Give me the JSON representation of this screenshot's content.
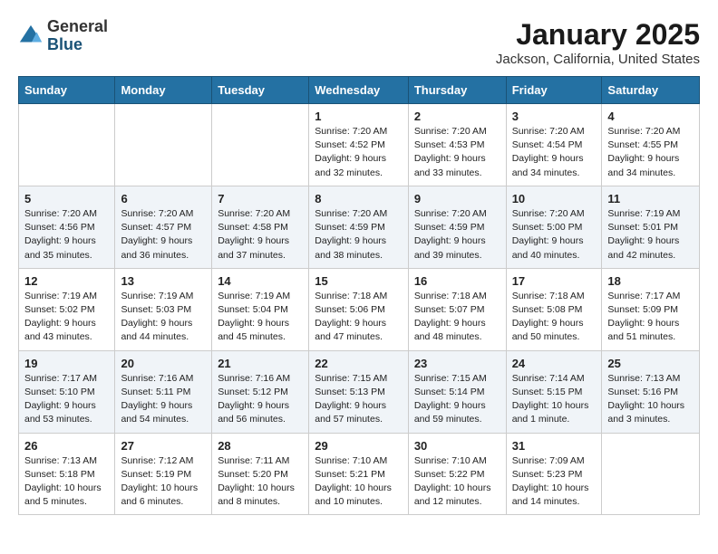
{
  "logo": {
    "general": "General",
    "blue": "Blue"
  },
  "title": "January 2025",
  "subtitle": "Jackson, California, United States",
  "days_of_week": [
    "Sunday",
    "Monday",
    "Tuesday",
    "Wednesday",
    "Thursday",
    "Friday",
    "Saturday"
  ],
  "weeks": [
    [
      {
        "day": "",
        "info": ""
      },
      {
        "day": "",
        "info": ""
      },
      {
        "day": "",
        "info": ""
      },
      {
        "day": "1",
        "info": "Sunrise: 7:20 AM\nSunset: 4:52 PM\nDaylight: 9 hours and 32 minutes."
      },
      {
        "day": "2",
        "info": "Sunrise: 7:20 AM\nSunset: 4:53 PM\nDaylight: 9 hours and 33 minutes."
      },
      {
        "day": "3",
        "info": "Sunrise: 7:20 AM\nSunset: 4:54 PM\nDaylight: 9 hours and 34 minutes."
      },
      {
        "day": "4",
        "info": "Sunrise: 7:20 AM\nSunset: 4:55 PM\nDaylight: 9 hours and 34 minutes."
      }
    ],
    [
      {
        "day": "5",
        "info": "Sunrise: 7:20 AM\nSunset: 4:56 PM\nDaylight: 9 hours and 35 minutes."
      },
      {
        "day": "6",
        "info": "Sunrise: 7:20 AM\nSunset: 4:57 PM\nDaylight: 9 hours and 36 minutes."
      },
      {
        "day": "7",
        "info": "Sunrise: 7:20 AM\nSunset: 4:58 PM\nDaylight: 9 hours and 37 minutes."
      },
      {
        "day": "8",
        "info": "Sunrise: 7:20 AM\nSunset: 4:59 PM\nDaylight: 9 hours and 38 minutes."
      },
      {
        "day": "9",
        "info": "Sunrise: 7:20 AM\nSunset: 4:59 PM\nDaylight: 9 hours and 39 minutes."
      },
      {
        "day": "10",
        "info": "Sunrise: 7:20 AM\nSunset: 5:00 PM\nDaylight: 9 hours and 40 minutes."
      },
      {
        "day": "11",
        "info": "Sunrise: 7:19 AM\nSunset: 5:01 PM\nDaylight: 9 hours and 42 minutes."
      }
    ],
    [
      {
        "day": "12",
        "info": "Sunrise: 7:19 AM\nSunset: 5:02 PM\nDaylight: 9 hours and 43 minutes."
      },
      {
        "day": "13",
        "info": "Sunrise: 7:19 AM\nSunset: 5:03 PM\nDaylight: 9 hours and 44 minutes."
      },
      {
        "day": "14",
        "info": "Sunrise: 7:19 AM\nSunset: 5:04 PM\nDaylight: 9 hours and 45 minutes."
      },
      {
        "day": "15",
        "info": "Sunrise: 7:18 AM\nSunset: 5:06 PM\nDaylight: 9 hours and 47 minutes."
      },
      {
        "day": "16",
        "info": "Sunrise: 7:18 AM\nSunset: 5:07 PM\nDaylight: 9 hours and 48 minutes."
      },
      {
        "day": "17",
        "info": "Sunrise: 7:18 AM\nSunset: 5:08 PM\nDaylight: 9 hours and 50 minutes."
      },
      {
        "day": "18",
        "info": "Sunrise: 7:17 AM\nSunset: 5:09 PM\nDaylight: 9 hours and 51 minutes."
      }
    ],
    [
      {
        "day": "19",
        "info": "Sunrise: 7:17 AM\nSunset: 5:10 PM\nDaylight: 9 hours and 53 minutes."
      },
      {
        "day": "20",
        "info": "Sunrise: 7:16 AM\nSunset: 5:11 PM\nDaylight: 9 hours and 54 minutes."
      },
      {
        "day": "21",
        "info": "Sunrise: 7:16 AM\nSunset: 5:12 PM\nDaylight: 9 hours and 56 minutes."
      },
      {
        "day": "22",
        "info": "Sunrise: 7:15 AM\nSunset: 5:13 PM\nDaylight: 9 hours and 57 minutes."
      },
      {
        "day": "23",
        "info": "Sunrise: 7:15 AM\nSunset: 5:14 PM\nDaylight: 9 hours and 59 minutes."
      },
      {
        "day": "24",
        "info": "Sunrise: 7:14 AM\nSunset: 5:15 PM\nDaylight: 10 hours and 1 minute."
      },
      {
        "day": "25",
        "info": "Sunrise: 7:13 AM\nSunset: 5:16 PM\nDaylight: 10 hours and 3 minutes."
      }
    ],
    [
      {
        "day": "26",
        "info": "Sunrise: 7:13 AM\nSunset: 5:18 PM\nDaylight: 10 hours and 5 minutes."
      },
      {
        "day": "27",
        "info": "Sunrise: 7:12 AM\nSunset: 5:19 PM\nDaylight: 10 hours and 6 minutes."
      },
      {
        "day": "28",
        "info": "Sunrise: 7:11 AM\nSunset: 5:20 PM\nDaylight: 10 hours and 8 minutes."
      },
      {
        "day": "29",
        "info": "Sunrise: 7:10 AM\nSunset: 5:21 PM\nDaylight: 10 hours and 10 minutes."
      },
      {
        "day": "30",
        "info": "Sunrise: 7:10 AM\nSunset: 5:22 PM\nDaylight: 10 hours and 12 minutes."
      },
      {
        "day": "31",
        "info": "Sunrise: 7:09 AM\nSunset: 5:23 PM\nDaylight: 10 hours and 14 minutes."
      },
      {
        "day": "",
        "info": ""
      }
    ]
  ]
}
